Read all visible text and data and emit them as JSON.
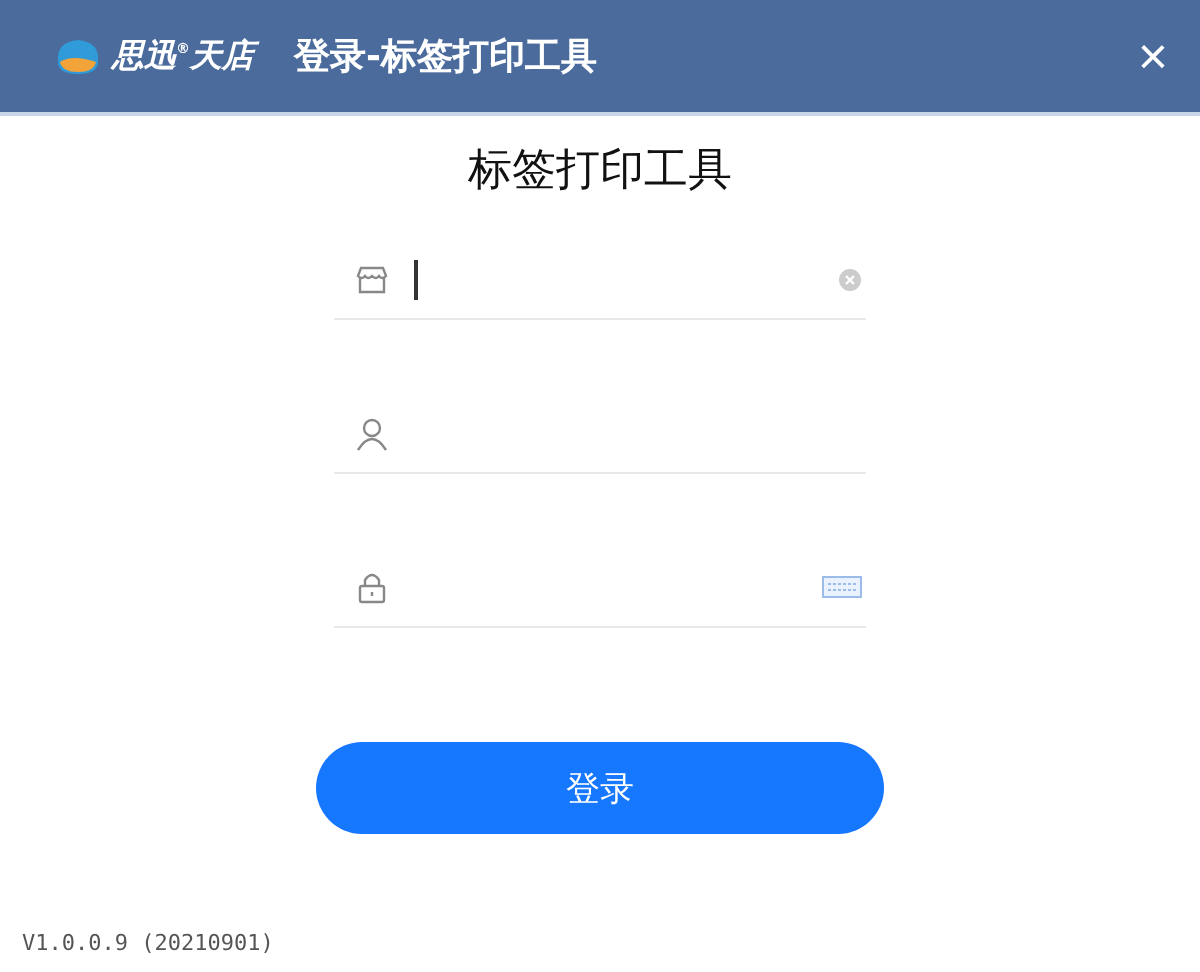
{
  "window": {
    "brand": "思迅$^{®}$天店",
    "title": "登录-标签打印工具",
    "close": "×"
  },
  "heading": "标签打印工具",
  "fields": [
    {
      "kind": "store",
      "focused": true,
      "clearable": true
    },
    {
      "kind": "user",
      "focused": false,
      "clearable": false
    },
    {
      "kind": "password",
      "focused": false,
      "clearable": false
    }
  ],
  "login_button": "登录",
  "version": "V1.0.0.9 (20210901)"
}
